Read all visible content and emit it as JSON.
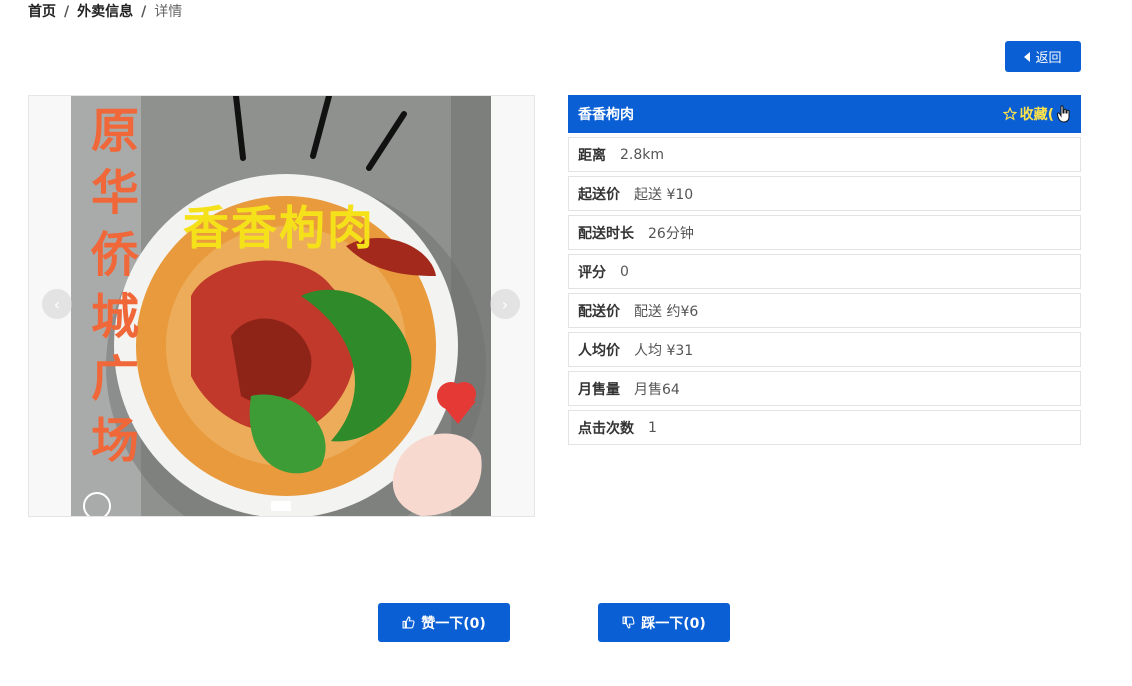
{
  "breadcrumb": {
    "home": "首页",
    "list": "外卖信息",
    "current": "详情",
    "separator": "/"
  },
  "back_button": {
    "label": "返回"
  },
  "carousel": {
    "vertical_text": [
      "原",
      "华",
      "侨",
      "城",
      "广",
      "场"
    ],
    "dish_caption": "香香枸肉"
  },
  "info": {
    "title": "香香枸肉",
    "favorite_label": "收藏(",
    "rows": [
      {
        "label": "距离",
        "value": "2.8km"
      },
      {
        "label": "起送价",
        "value": "起送 ¥10"
      },
      {
        "label": "配送时长",
        "value": "26分钟"
      },
      {
        "label": "评分",
        "value": "0"
      },
      {
        "label": "配送价",
        "value": "配送 约¥6"
      },
      {
        "label": "人均价",
        "value": "人均 ¥31"
      },
      {
        "label": "月售量",
        "value": "月售64"
      },
      {
        "label": "点击次数",
        "value": "1"
      }
    ]
  },
  "actions": {
    "like_label": "赞一下(0)",
    "dislike_label": "踩一下(0)"
  },
  "colors": {
    "primary": "#0a5fd4",
    "favorite": "#ffe34a"
  }
}
